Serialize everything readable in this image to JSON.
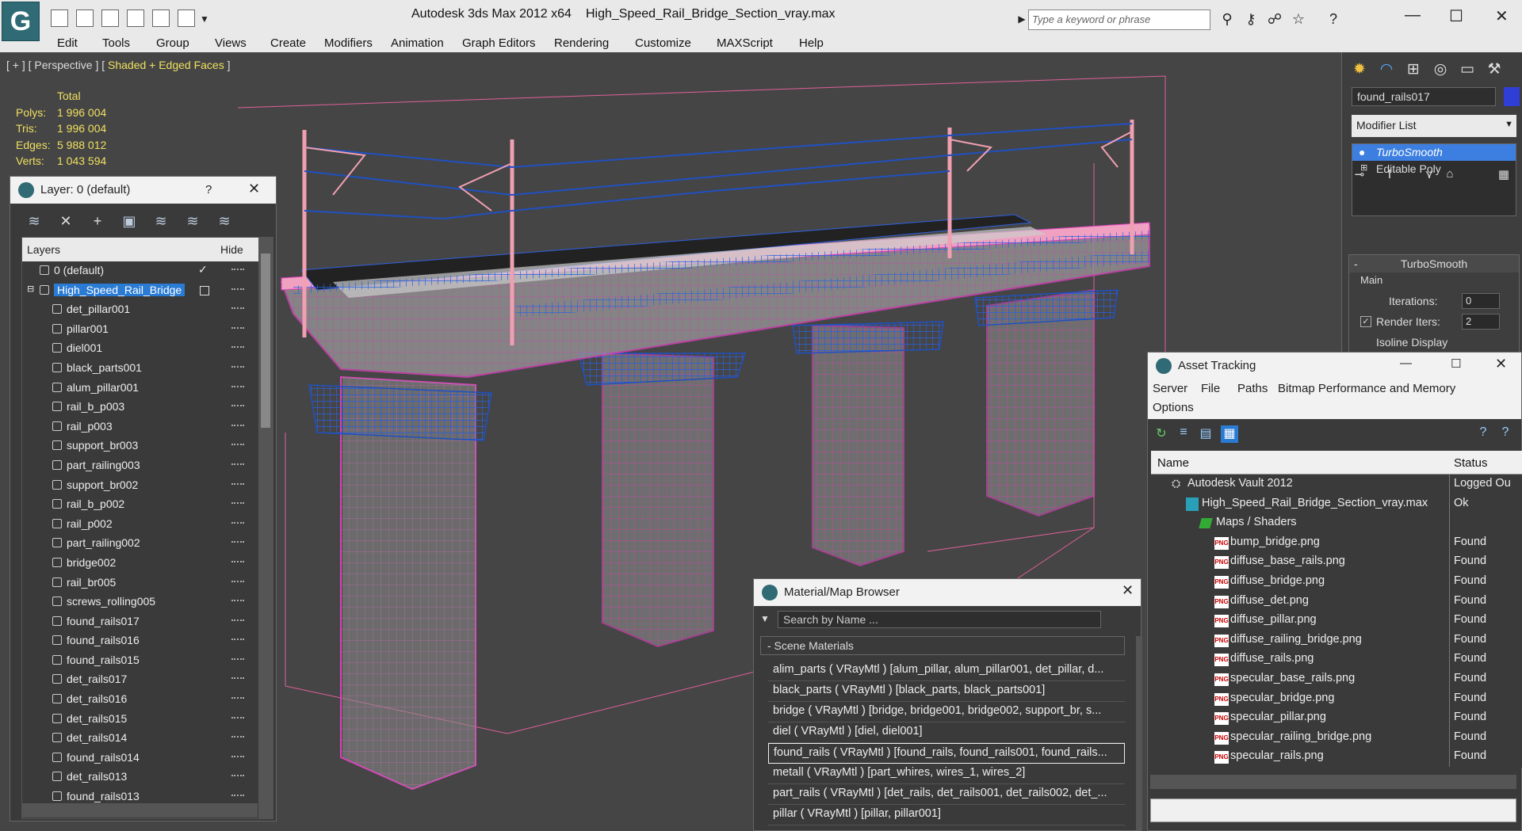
{
  "titlebar": {
    "app_title": "Autodesk 3ds Max  2012 x64",
    "file_title": "High_Speed_Rail_Bridge_Section_vray.max",
    "search_placeholder": "Type a keyword or phrase"
  },
  "menu": [
    "Edit",
    "Tools",
    "Group",
    "Views",
    "Create",
    "Modifiers",
    "Animation",
    "Graph Editors",
    "Rendering",
    "Customize",
    "MAXScript",
    "Help"
  ],
  "viewport": {
    "label_prefix": "[ + ] [ Perspective ] [ ",
    "label_mode": "Shaded + Edged Faces",
    "label_suffix": " ]",
    "stats": {
      "header": "Total",
      "rows": [
        {
          "label": "Polys:",
          "value": "1 996 004"
        },
        {
          "label": "Tris:",
          "value": "1 996 004"
        },
        {
          "label": "Edges:",
          "value": "5 988 012"
        },
        {
          "label": "Verts:",
          "value": "1 043 594"
        }
      ]
    }
  },
  "layer_panel": {
    "title": "Layer: 0 (default)",
    "help": "?",
    "header_layers": "Layers",
    "header_hide": "Hide",
    "rows": [
      {
        "name": "0 (default)",
        "type": "layer",
        "checked": true
      },
      {
        "name": "High_Speed_Rail_Bridge",
        "type": "layer",
        "selected": true
      },
      {
        "name": "det_pillar001",
        "type": "object"
      },
      {
        "name": "pillar001",
        "type": "object"
      },
      {
        "name": "diel001",
        "type": "object"
      },
      {
        "name": "black_parts001",
        "type": "object"
      },
      {
        "name": "alum_pillar001",
        "type": "object"
      },
      {
        "name": "rail_b_p003",
        "type": "object"
      },
      {
        "name": "rail_p003",
        "type": "object"
      },
      {
        "name": "support_br003",
        "type": "object"
      },
      {
        "name": "part_railing003",
        "type": "object"
      },
      {
        "name": "support_br002",
        "type": "object"
      },
      {
        "name": "rail_b_p002",
        "type": "object"
      },
      {
        "name": "rail_p002",
        "type": "object"
      },
      {
        "name": "part_railing002",
        "type": "object"
      },
      {
        "name": "bridge002",
        "type": "object"
      },
      {
        "name": "rail_br005",
        "type": "object"
      },
      {
        "name": "screws_rolling005",
        "type": "object"
      },
      {
        "name": "found_rails017",
        "type": "object"
      },
      {
        "name": "found_rails016",
        "type": "object"
      },
      {
        "name": "found_rails015",
        "type": "object"
      },
      {
        "name": "det_rails017",
        "type": "object"
      },
      {
        "name": "det_rails016",
        "type": "object"
      },
      {
        "name": "det_rails015",
        "type": "object"
      },
      {
        "name": "det_rails014",
        "type": "object"
      },
      {
        "name": "found_rails014",
        "type": "object"
      },
      {
        "name": "det_rails013",
        "type": "object"
      },
      {
        "name": "found_rails013",
        "type": "object"
      }
    ]
  },
  "command_panel": {
    "object_name": "found_rails017",
    "object_color": "#2f3fd6",
    "modifier_list_label": "Modifier List",
    "stack": [
      {
        "name": "TurboSmooth",
        "selected": true
      },
      {
        "name": "Editable Poly",
        "selected": false
      }
    ],
    "rollout_title": "TurboSmooth",
    "group_main": "Main",
    "iterations_label": "Iterations:",
    "iterations_value": "0",
    "render_iters_label": "Render Iters:",
    "render_iters_value": "2",
    "isoline_label": "Isoline Display"
  },
  "asset_panel": {
    "title": "Asset Tracking",
    "menu": [
      "Server",
      "File",
      "Paths",
      "Bitmap Performance and Memory",
      "Options"
    ],
    "col_name": "Name",
    "col_status": "Status",
    "rows": [
      {
        "name": "Autodesk Vault 2012",
        "status": "Logged Ou",
        "indent": 0,
        "icon": "vault"
      },
      {
        "name": "High_Speed_Rail_Bridge_Section_vray.max",
        "status": "Ok",
        "indent": 1,
        "icon": "max"
      },
      {
        "name": "Maps / Shaders",
        "status": "",
        "indent": 2,
        "icon": "maps"
      },
      {
        "name": "bump_bridge.png",
        "status": "Found",
        "indent": 3,
        "icon": "png"
      },
      {
        "name": "diffuse_base_rails.png",
        "status": "Found",
        "indent": 3,
        "icon": "png"
      },
      {
        "name": "diffuse_bridge.png",
        "status": "Found",
        "indent": 3,
        "icon": "png"
      },
      {
        "name": "diffuse_det.png",
        "status": "Found",
        "indent": 3,
        "icon": "png"
      },
      {
        "name": "diffuse_pillar.png",
        "status": "Found",
        "indent": 3,
        "icon": "png"
      },
      {
        "name": "diffuse_railing_bridge.png",
        "status": "Found",
        "indent": 3,
        "icon": "png"
      },
      {
        "name": "diffuse_rails.png",
        "status": "Found",
        "indent": 3,
        "icon": "png"
      },
      {
        "name": "specular_base_rails.png",
        "status": "Found",
        "indent": 3,
        "icon": "png"
      },
      {
        "name": "specular_bridge.png",
        "status": "Found",
        "indent": 3,
        "icon": "png"
      },
      {
        "name": "specular_pillar.png",
        "status": "Found",
        "indent": 3,
        "icon": "png"
      },
      {
        "name": "specular_railing_bridge.png",
        "status": "Found",
        "indent": 3,
        "icon": "png"
      },
      {
        "name": "specular_rails.png",
        "status": "Found",
        "indent": 3,
        "icon": "png"
      }
    ]
  },
  "material_panel": {
    "title": "Material/Map Browser",
    "search_placeholder": "Search by Name ...",
    "group": "- Scene Materials",
    "rows": [
      {
        "text": "alim_parts  ( VRayMtl )  [alum_pillar, alum_pillar001, det_pillar, d...",
        "selected": false
      },
      {
        "text": "black_parts  ( VRayMtl )  [black_parts, black_parts001]",
        "selected": false
      },
      {
        "text": "bridge  ( VRayMtl )  [bridge, bridge001, bridge002, support_br, s...",
        "selected": false
      },
      {
        "text": "diel  ( VRayMtl )  [diel, diel001]",
        "selected": false
      },
      {
        "text": "found_rails  ( VRayMtl )  [found_rails, found_rails001, found_rails...",
        "selected": true
      },
      {
        "text": "metall  ( VRayMtl )  [part_whires, wires_1, wires_2]",
        "selected": false
      },
      {
        "text": "part_rails  ( VRayMtl )  [det_rails, det_rails001, det_rails002, det_...",
        "selected": false
      },
      {
        "text": "pillar  ( VRayMtl )  [pillar, pillar001]",
        "selected": false
      }
    ]
  },
  "colors": {
    "accent": "#2a7bd4",
    "stats_yellow": "#f0e060",
    "wire_magenta": "#e040c0",
    "wire_blue": "#2060e0",
    "wire_pink": "#f0a0b0"
  }
}
